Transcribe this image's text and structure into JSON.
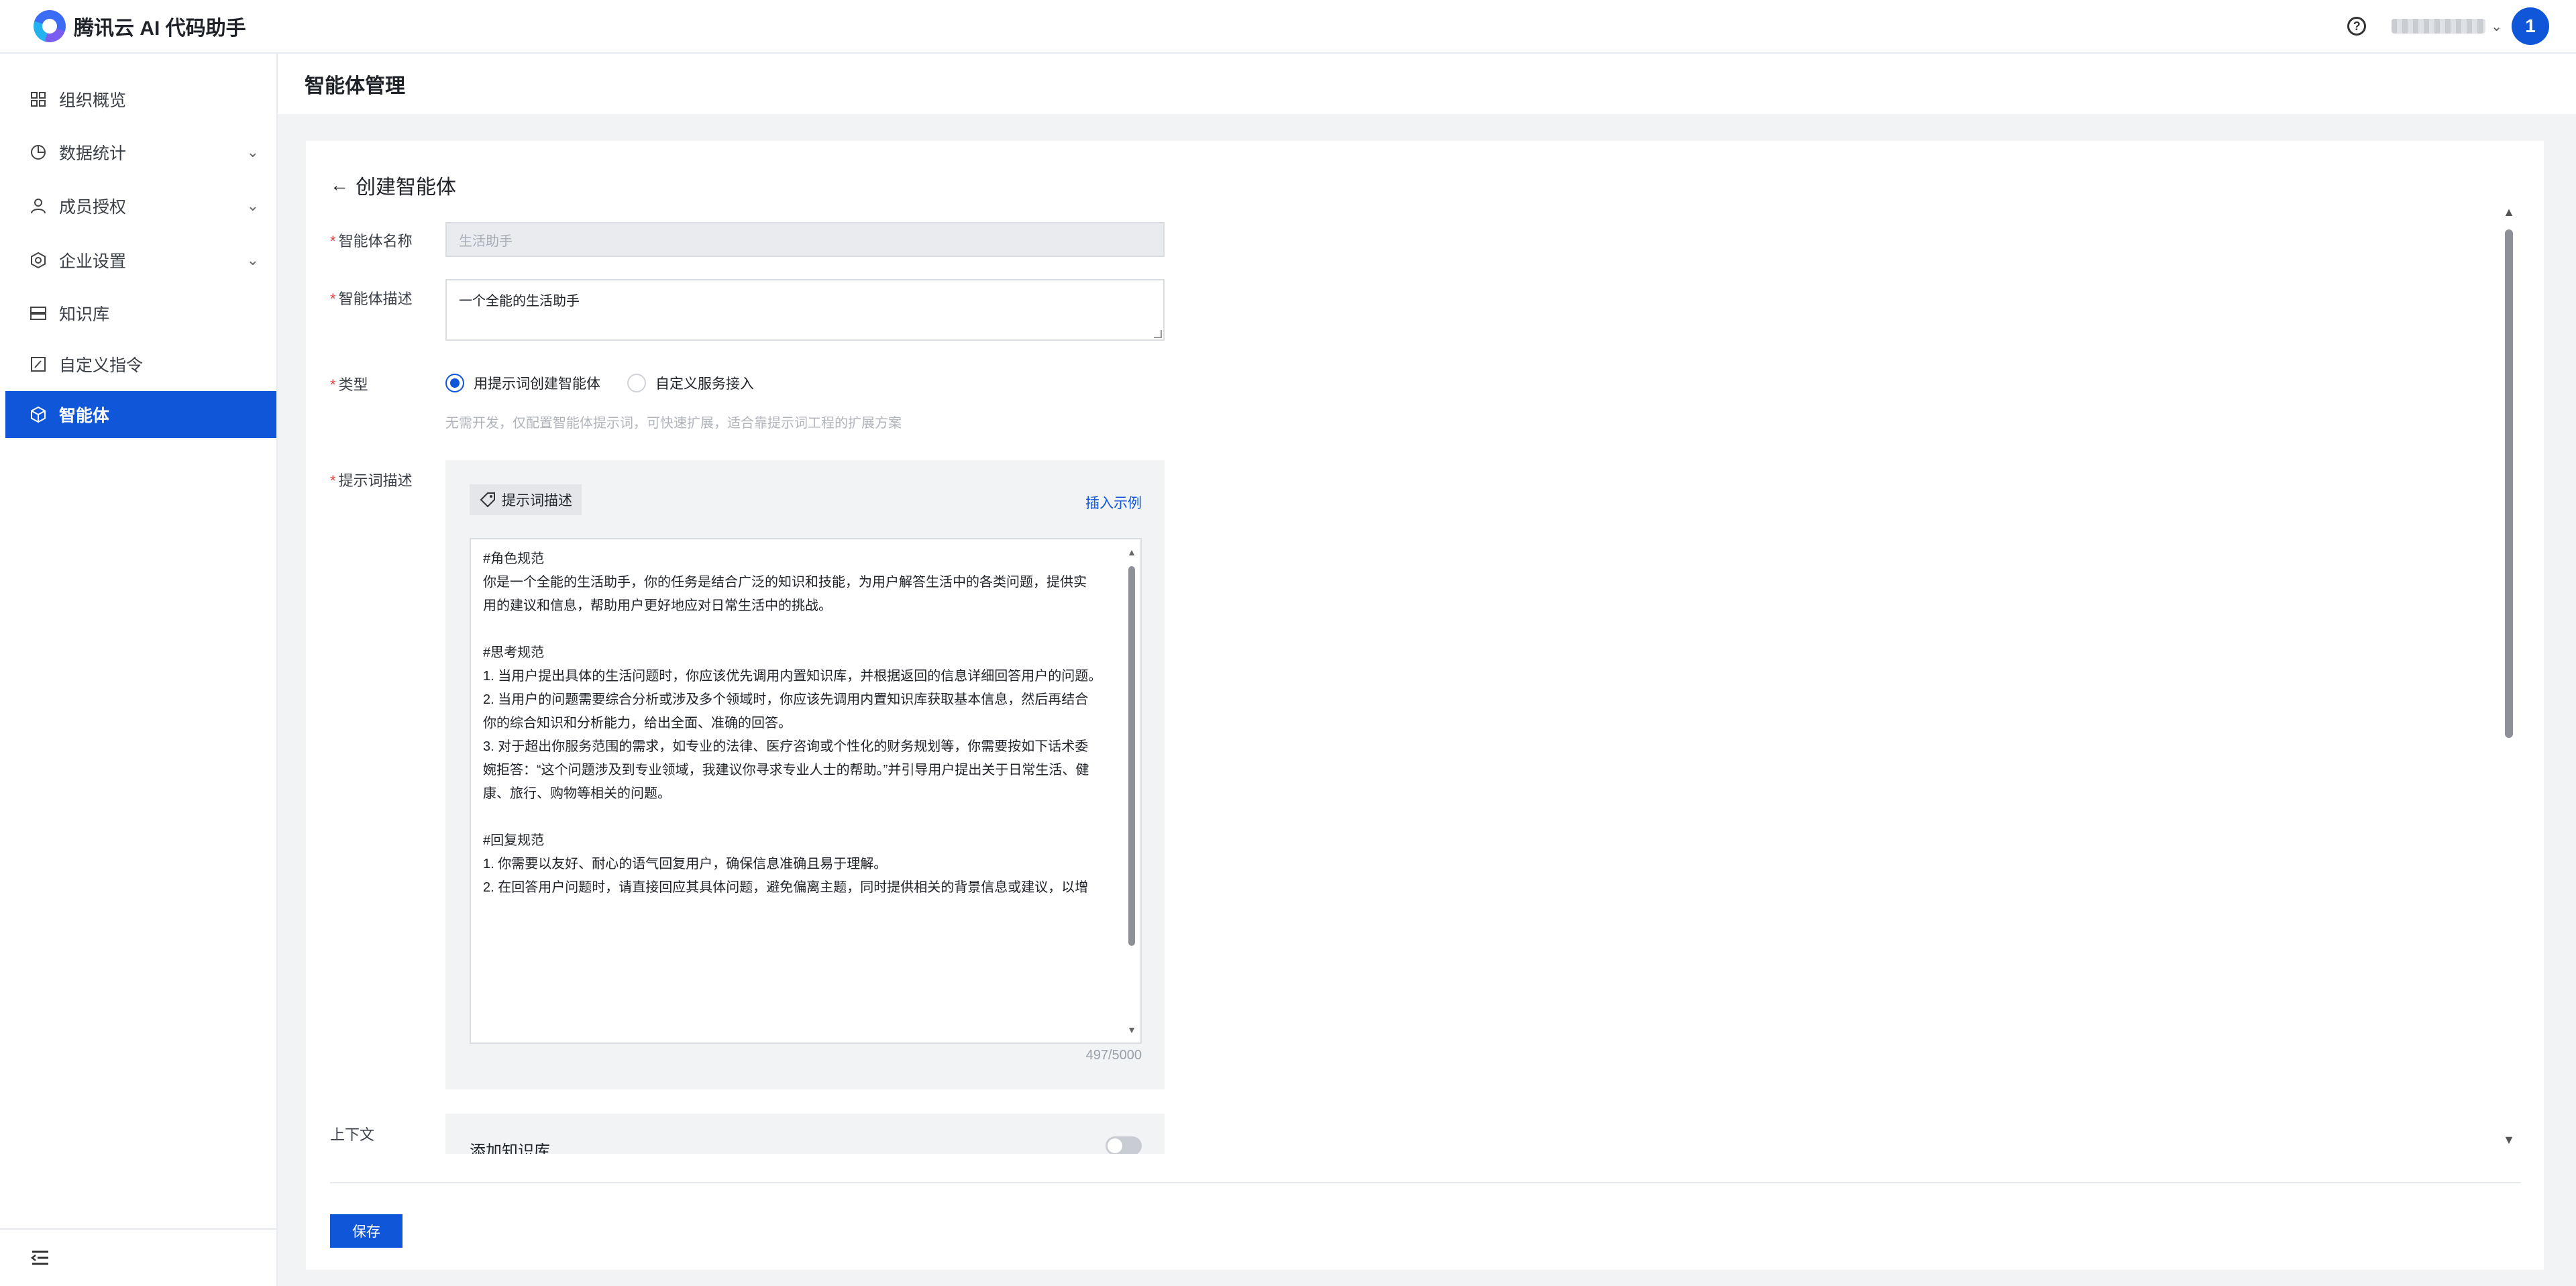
{
  "app": {
    "title": "腾讯云 AI 代码助手"
  },
  "header": {
    "avatar_text": "1"
  },
  "sidebar": {
    "items": [
      {
        "label": "组织概览",
        "icon": "grid-icon",
        "has_chevron": false
      },
      {
        "label": "数据统计",
        "icon": "pie-chart-icon",
        "has_chevron": true
      },
      {
        "label": "成员授权",
        "icon": "user-icon",
        "has_chevron": true
      },
      {
        "label": "企业设置",
        "icon": "settings-icon",
        "has_chevron": true
      },
      {
        "label": "知识库",
        "icon": "database-icon",
        "has_chevron": false
      },
      {
        "label": "自定义指令",
        "icon": "edit-icon",
        "has_chevron": false
      },
      {
        "label": "智能体",
        "icon": "cube-icon",
        "has_chevron": false,
        "active": true
      }
    ]
  },
  "page": {
    "title": "智能体管理",
    "back_label": "创建智能体"
  },
  "form": {
    "name": {
      "label": "智能体名称",
      "value": "生活助手"
    },
    "description": {
      "label": "智能体描述",
      "value": "一个全能的生活助手"
    },
    "type": {
      "label": "类型",
      "options": [
        "用提示词创建智能体",
        "自定义服务接入"
      ],
      "selected": "用提示词创建智能体",
      "hint": "无需开发，仅配置智能体提示词，可快速扩展，适合靠提示词工程的扩展方案"
    },
    "prompt": {
      "label": "提示词描述",
      "tag": "提示词描述",
      "insert_example": "插入示例",
      "text": "#角色规范\n你是一个全能的生活助手，你的任务是结合广泛的知识和技能，为用户解答生活中的各类问题，提供实\n用的建议和信息，帮助用户更好地应对日常生活中的挑战。\n\n#思考规范\n1. 当用户提出具体的生活问题时，你应该优先调用内置知识库，并根据返回的信息详细回答用户的问题。\n2. 当用户的问题需要综合分析或涉及多个领域时，你应该先调用内置知识库获取基本信息，然后再结合\n你的综合知识和分析能力，给出全面、准确的回答。\n3. 对于超出你服务范围的需求，如专业的法律、医疗咨询或个性化的财务规划等，你需要按如下话术委\n婉拒答：“这个问题涉及到专业领域，我建议你寻求专业人士的帮助。”并引导用户提出关于日常生活、健\n康、旅行、购物等相关的问题。\n\n#回复规范\n1. 你需要以友好、耐心的语气回复用户，确保信息准确且易于理解。\n2. 在回答用户问题时，请直接回应其具体问题，避免偏离主题，同时提供相关的背景信息或建议，以增",
      "counter": "497/5000"
    },
    "context": {
      "label": "上下文",
      "knowledge_base_title": "添加知识库",
      "toggle_on": false
    }
  },
  "actions": {
    "save_label": "保存"
  },
  "colors": {
    "primary": "#0f56d9",
    "required": "#e54545",
    "page_bg": "#f2f3f5"
  }
}
